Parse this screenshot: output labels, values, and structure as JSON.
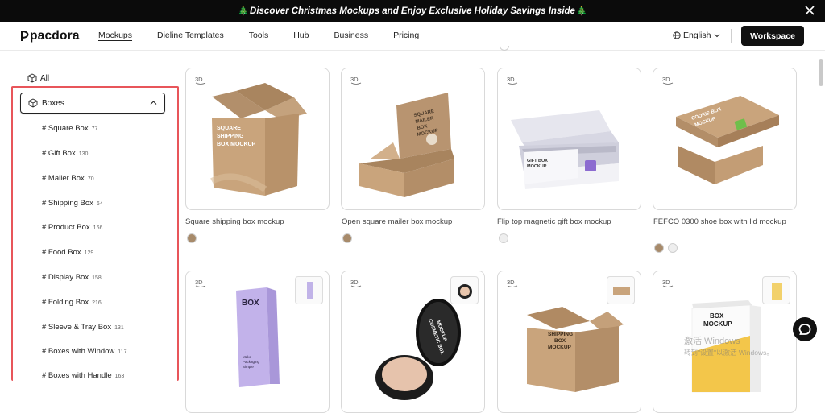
{
  "promo": {
    "text": "Discover Christmas Mockups and Enjoy Exclusive Holiday Savings Inside",
    "emoji": "🎄"
  },
  "header": {
    "logo": "pacdora",
    "nav": [
      "Mockups",
      "Dieline Templates",
      "Tools",
      "Hub",
      "Business",
      "Pricing"
    ],
    "active_nav": "Mockups",
    "language": "English",
    "workspace_label": "Workspace"
  },
  "sidebar": {
    "all_label": "All",
    "category_label": "Boxes",
    "subcategories": [
      {
        "label": "# Square Box",
        "count": "77"
      },
      {
        "label": "# Gift Box",
        "count": "130"
      },
      {
        "label": "# Mailer Box",
        "count": "70"
      },
      {
        "label": "# Shipping Box",
        "count": "64"
      },
      {
        "label": "# Product Box",
        "count": "166"
      },
      {
        "label": "# Food Box",
        "count": "129"
      },
      {
        "label": "# Display Box",
        "count": "158"
      },
      {
        "label": "# Folding Box",
        "count": "216"
      },
      {
        "label": "# Sleeve & Tray Box",
        "count": "131"
      },
      {
        "label": "# Boxes with Window",
        "count": "117"
      },
      {
        "label": "# Boxes with Handle",
        "count": "163"
      }
    ]
  },
  "cards": [
    {
      "badge": "3D",
      "title": "Square shipping box mockup",
      "box_text": "SQUARE SHIPPING BOX MOCKUP",
      "swatches": [
        "#a78a6a"
      ]
    },
    {
      "badge": "3D",
      "title": "Open square mailer box mockup",
      "box_text": "SQUARE MAILER BOX MOCKUP",
      "swatches": [
        "#a78a6a"
      ]
    },
    {
      "badge": "3D",
      "title": "Flip top magnetic gift box mockup",
      "box_text": "GIFT BOX MOCKUP",
      "swatches": [
        "#e6e6e6"
      ]
    },
    {
      "badge": "3D",
      "title": "FEFCO 0300 shoe box with lid mockup",
      "box_text": "COOKIE BOX MOCKUP",
      "swatches": [
        "#a78a6a",
        "#e6e6e6"
      ]
    },
    {
      "badge": "3D",
      "title": "",
      "box_text": "BOX",
      "box_subtext": "Make Packaging Simple",
      "swatches": []
    },
    {
      "badge": "3D",
      "title": "",
      "box_text": "COSMETIC BOX MOCKUP",
      "swatches": []
    },
    {
      "badge": "3D",
      "title": "",
      "box_text": "SHIPPING BOX MOCKUP",
      "swatches": []
    },
    {
      "badge": "3D",
      "title": "",
      "box_text": "BOX MOCKUP",
      "swatches": []
    }
  ],
  "watermark": {
    "line1": "激活 Windows",
    "line2": "转到\"设置\"以激活 Windows。"
  },
  "colors": {
    "accent": "#111111",
    "highlight_border": "#e8555a",
    "kraft": "#c9a47c",
    "banner_bg": "#0b0b0b"
  }
}
